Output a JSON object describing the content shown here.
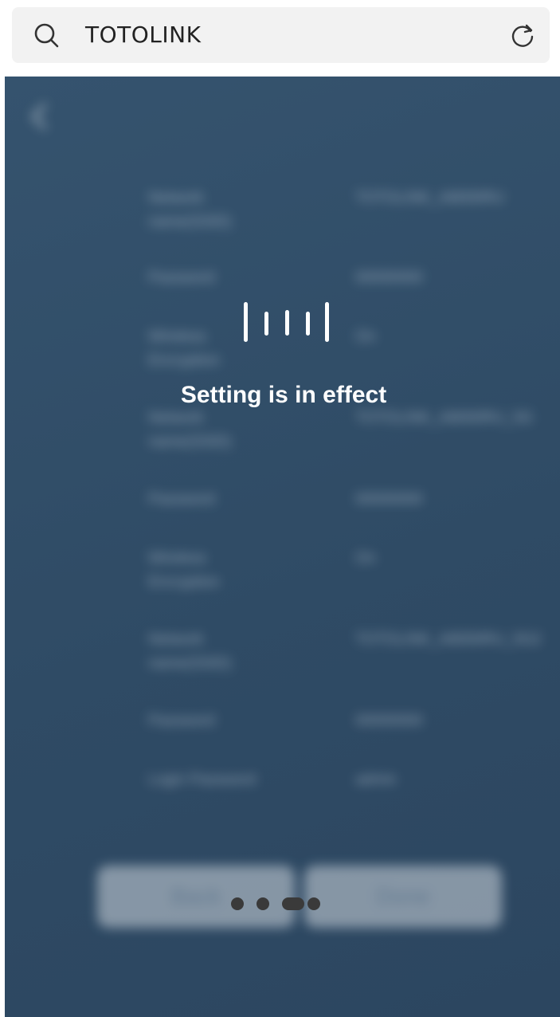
{
  "browser": {
    "query": "TOTOLINK",
    "icons": {
      "search": "search-icon",
      "refresh": "refresh-icon"
    }
  },
  "form": {
    "rows": [
      {
        "label": "Network name(SSID)",
        "value": "TOTOLINK_A8000RU"
      },
      {
        "label": "Password",
        "value": "00000000"
      },
      {
        "label": "Wireless Encryption",
        "value": "On"
      },
      {
        "label": "Network name(SSID)",
        "value": "TOTOLINK_A8000RU_5G"
      },
      {
        "label": "Password",
        "value": "00000000"
      },
      {
        "label": "Wireless Encryption",
        "value": "On"
      },
      {
        "label": "Network name(SSID)",
        "value": "TOTOLINK_A8000RU_5G2"
      },
      {
        "label": "Password",
        "value": "00000000"
      },
      {
        "label": "Login Password",
        "value": "admin"
      }
    ],
    "back_label": "Back",
    "done_label": "Done"
  },
  "overlay": {
    "status_text": "Setting is in effect"
  },
  "colors": {
    "background": "#2f4b65",
    "overlay_text": "#ffffff"
  }
}
